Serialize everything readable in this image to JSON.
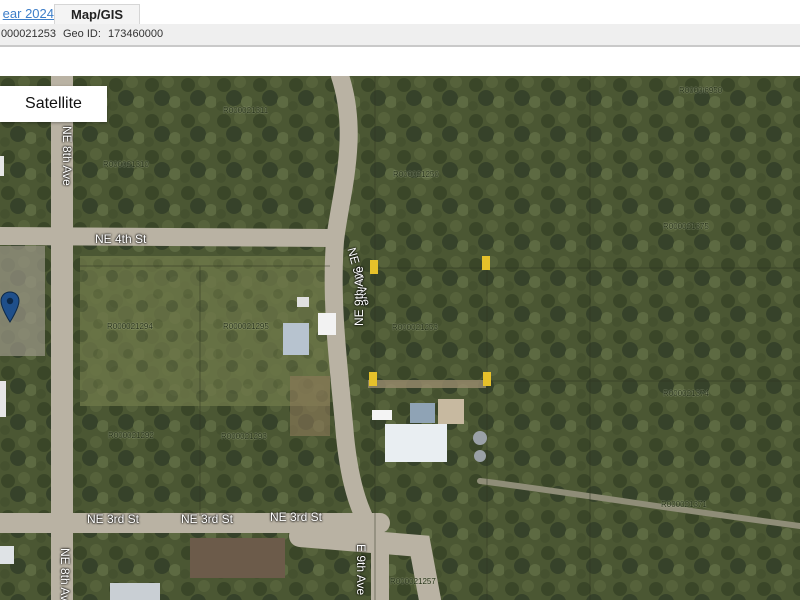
{
  "tabs": {
    "previous_label": "ear 2024",
    "active_label": "Map/GIS"
  },
  "info": {
    "property_id_partial": "000021253",
    "geo_id_label": "Geo ID:",
    "geo_id_value": "173460000"
  },
  "map": {
    "basemap_button": "Satellite",
    "street_labels": {
      "ne_4th_st": "NE 4th St",
      "ne_3rd_st_1": "NE 3rd St",
      "ne_3rd_st_2": "NE 3rd St",
      "ne_3rd_st_3": "NE 3rd St",
      "ne_8th_ave_top": "NE 8th Ave",
      "ne_8th_ave_bottom": "NE 8th Ave",
      "ne_9th_ave_1": "NE 9th Ave",
      "ne_9th_ave_2": "NE 9th Ave",
      "ne_9th_ave_bottom": "E 9th Ave"
    },
    "parcel_labels": {
      "p1": "R000021311",
      "p2": "R000021310",
      "p3": "R000021250",
      "p4": "R000021375",
      "p5": "R000021294",
      "p6": "R000021295",
      "p7": "R000021253",
      "p8": "R000021292",
      "p9": "R000021293",
      "p10": "R000021374",
      "p11": "R000021371",
      "p12": "R000021257",
      "p13": "R0000i6950"
    },
    "colors": {
      "vegetation_dark": "#3e4a2b",
      "vegetation_light": "#6f7b4d",
      "road": "#b9b2a3",
      "marker": "#1f4f8a",
      "parcel_corner": "#e6c12a"
    },
    "marker_icon": "map-pin-icon"
  }
}
